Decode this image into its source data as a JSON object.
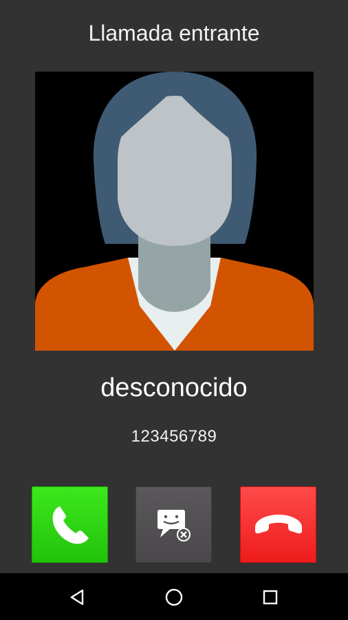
{
  "header": {
    "title": "Llamada entrante"
  },
  "caller": {
    "name": "desconocido",
    "number": "123456789",
    "avatar_icon": "person-placeholder-icon"
  },
  "actions": {
    "answer": {
      "icon": "phone-answer-icon",
      "color": "#2ed412"
    },
    "message": {
      "icon": "message-reject-icon",
      "color": "#525052"
    },
    "decline": {
      "icon": "phone-hangup-icon",
      "color": "#f52828"
    }
  },
  "navbar": {
    "back_icon": "back-triangle-icon",
    "home_icon": "home-circle-icon",
    "recents_icon": "recents-square-icon"
  }
}
